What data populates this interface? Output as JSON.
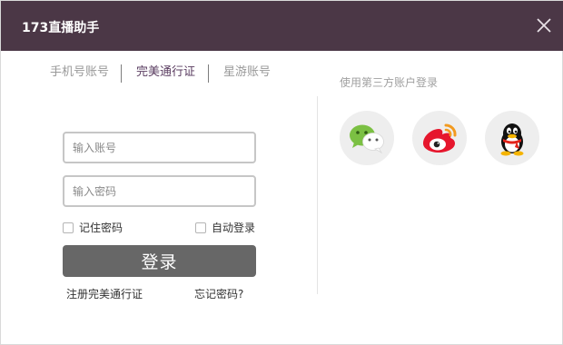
{
  "window": {
    "title": "173直播助手",
    "colors": {
      "titlebar": "#4b3746",
      "active_tab": "#5a3c60",
      "login_button": "#676767"
    }
  },
  "tabs": [
    {
      "label": "手机号账号",
      "active": false
    },
    {
      "label": "完美通行证",
      "active": true
    },
    {
      "label": "星游账号",
      "active": false
    }
  ],
  "form": {
    "account_placeholder": "输入账号",
    "password_placeholder": "输入密码",
    "remember_label": "记住密码",
    "auto_login_label": "自动登录",
    "login_label": "登录",
    "register_link": "注册完美通行证",
    "forgot_link": "忘记密码?"
  },
  "third_party": {
    "label": "使用第三方账户登录",
    "providers": [
      {
        "name": "wechat",
        "icon": "wechat-icon"
      },
      {
        "name": "weibo",
        "icon": "weibo-icon"
      },
      {
        "name": "qq",
        "icon": "qq-icon"
      }
    ]
  },
  "icons": {
    "close": "close-icon"
  }
}
